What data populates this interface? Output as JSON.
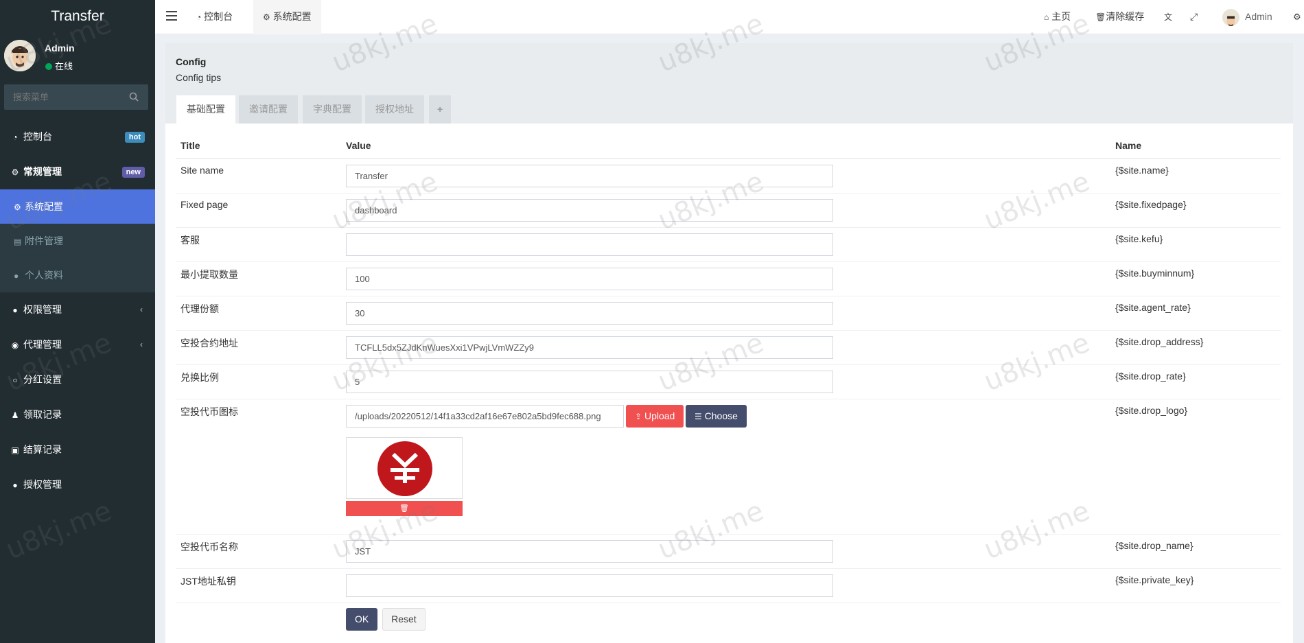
{
  "sidebar": {
    "logo": "Transfer",
    "user": {
      "name": "Admin",
      "status": "在线"
    },
    "search_placeholder": "搜索菜单",
    "menu": {
      "dashboard": {
        "label": "控制台",
        "badge": "hot"
      },
      "general": {
        "label": "常规管理",
        "badge": "new"
      },
      "sub": {
        "sysconfig": "系统配置",
        "attachment": "附件管理",
        "profile": "个人资料"
      },
      "auth": "权限管理",
      "agent": "代理管理",
      "dividend": "分红设置",
      "claims": "领取记录",
      "settlement": "结算记录",
      "license": "授权管理"
    }
  },
  "header": {
    "tabs": {
      "dashboard": "控制台",
      "sysconfig": "系统配置"
    },
    "home": "主页",
    "clear_cache": "清除缓存",
    "user": "Admin"
  },
  "panel": {
    "title": "Config",
    "tips": "Config tips",
    "tabs": {
      "basic": "基础配置",
      "invite": "邀请配置",
      "dict": "字典配置",
      "authaddr": "授权地址",
      "add": "+"
    }
  },
  "table": {
    "headers": {
      "title": "Title",
      "value": "Value",
      "name": "Name"
    },
    "rows": [
      {
        "title": "Site name",
        "value": "Transfer",
        "name": "{$site.name}"
      },
      {
        "title": "Fixed page",
        "value": "dashboard",
        "name": "{$site.fixedpage}"
      },
      {
        "title": "客服",
        "value": "",
        "name": "{$site.kefu}"
      },
      {
        "title": "最小提取数量",
        "value": "100",
        "name": "{$site.buyminnum}"
      },
      {
        "title": "代理份额",
        "value": "30",
        "name": "{$site.agent_rate}"
      },
      {
        "title": "空投合约地址",
        "value": "TCFLL5dx5ZJdKnWuesXxi1VPwjLVmWZZy9",
        "name": "{$site.drop_address}"
      },
      {
        "title": "兑换比例",
        "value": "5",
        "name": "{$site.drop_rate}"
      },
      {
        "title": "空投代币图标",
        "value": "/uploads/20220512/14f1a33cd2af16e67e802a5bd9fec688.png",
        "name": "{$site.drop_logo}"
      },
      {
        "title": "空投代币名称",
        "value": "JST",
        "name": "{$site.drop_name}"
      },
      {
        "title": "JST地址私钥",
        "value": "",
        "name": "{$site.private_key}"
      }
    ],
    "upload_label": "Upload",
    "choose_label": "Choose",
    "ok_label": "OK",
    "reset_label": "Reset"
  },
  "watermark": "u8kj.me",
  "colors": {
    "sidebar": "#222d32",
    "active": "#4e73df",
    "danger": "#f05050",
    "primary": "#444d6b",
    "logo_red": "#c0171d"
  }
}
